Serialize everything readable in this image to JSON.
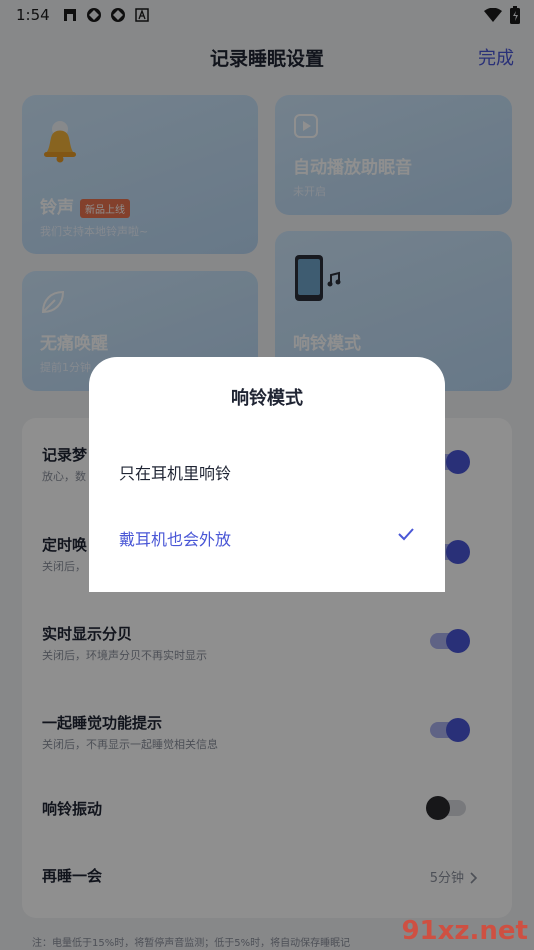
{
  "status_bar": {
    "time": "1:54"
  },
  "header": {
    "title": "记录睡眠设置",
    "done": "完成"
  },
  "cards": {
    "ringtone": {
      "title": "铃声",
      "badge": "新品上线",
      "subtitle": "我们支持本地铃声啦~"
    },
    "autoplay": {
      "title": "自动播放助眠音",
      "subtitle": "未开启"
    },
    "gentle_wake": {
      "title": "无痛唤醒",
      "subtitle": "提前1分钟"
    },
    "ring_mode": {
      "title": "响铃模式"
    }
  },
  "settings": [
    {
      "title": "记录梦",
      "subtitle": "放心，数",
      "toggle": "on"
    },
    {
      "title": "定时唤",
      "subtitle": "关闭后，",
      "toggle": "on"
    },
    {
      "title": "实时显示分贝",
      "subtitle": "关闭后，环境声分贝不再实时显示",
      "toggle": "on"
    },
    {
      "title": "一起睡觉功能提示",
      "subtitle": "关闭后，不再显示一起睡觉相关信息",
      "toggle": "on"
    },
    {
      "title": "响铃振动",
      "toggle": "off"
    },
    {
      "title": "再睡一会",
      "value": "5分钟"
    }
  ],
  "footnote": "注：电量低于15%时，将暂停声音监测；低于5%时，将自动保存睡眠记",
  "dialog": {
    "title": "响铃模式",
    "options": [
      {
        "label": "只在耳机里响铃",
        "selected": false
      },
      {
        "label": "戴耳机也会外放",
        "selected": true
      }
    ]
  },
  "watermark": "91xz.net",
  "colors": {
    "accent": "#4a57d6",
    "card": "#c4def6",
    "badge": "#e9734f"
  }
}
